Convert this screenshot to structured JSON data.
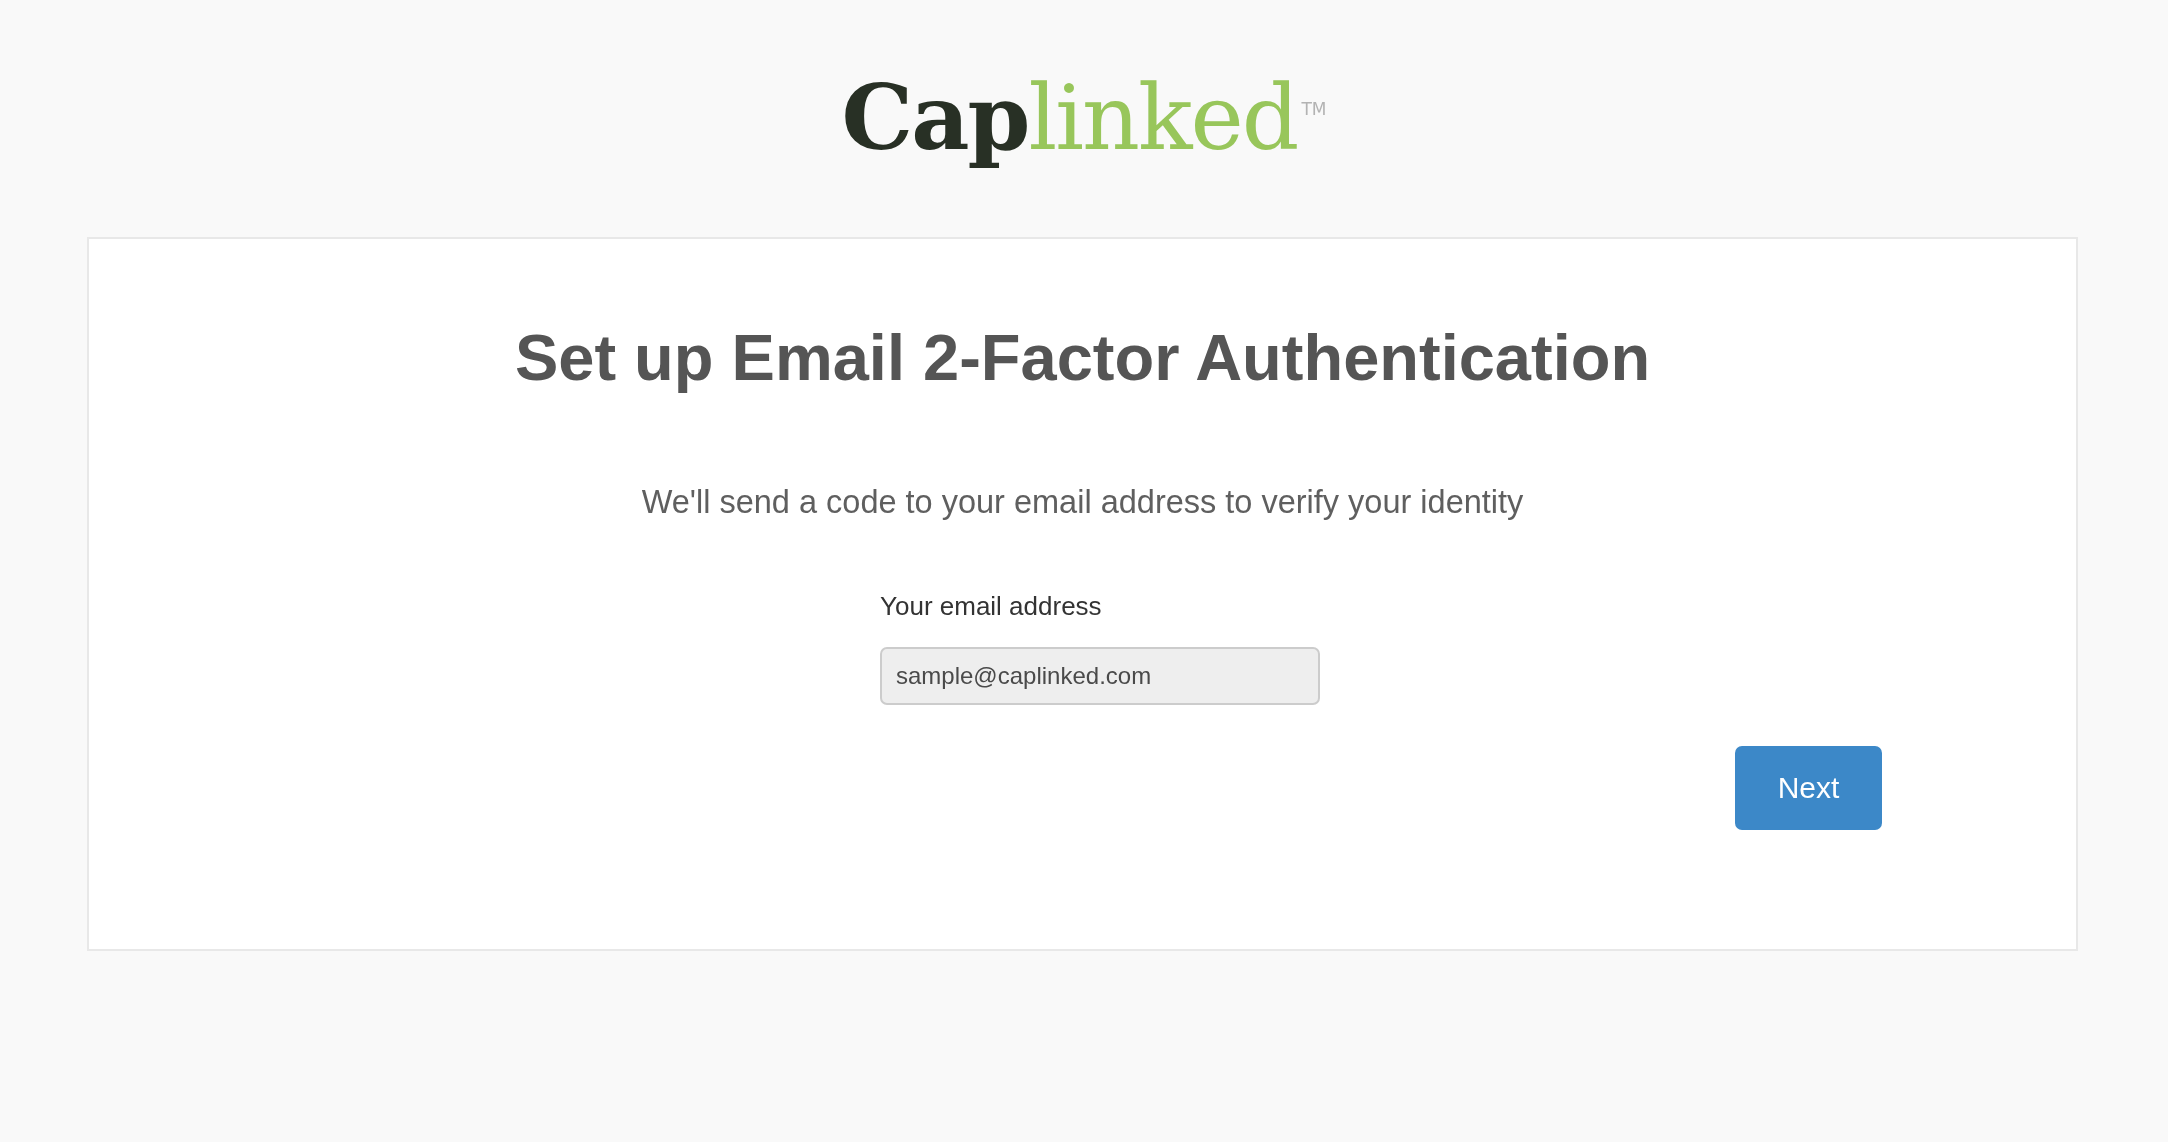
{
  "logo": {
    "primary": "Cap",
    "secondary": "linked",
    "trademark": "TM"
  },
  "card": {
    "title": "Set up Email 2-Factor Authentication",
    "description": "We'll send a code to your email address to verify your identity",
    "email_field": {
      "label": "Your email address",
      "value": "sample@caplinked.com",
      "disabled": true
    },
    "next_button": {
      "label": "Next"
    }
  }
}
